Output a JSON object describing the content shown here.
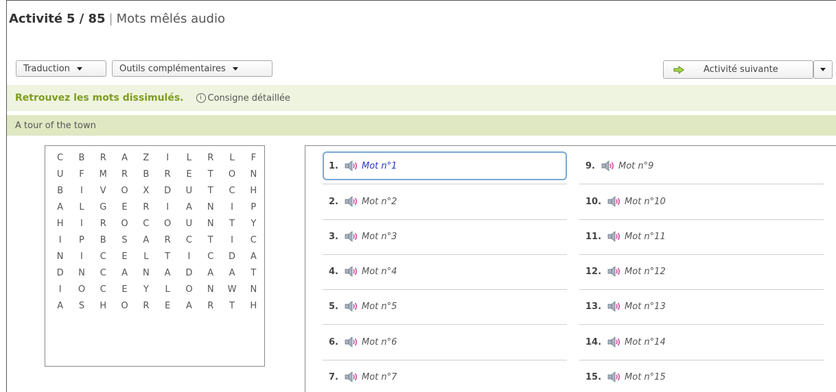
{
  "header": {
    "activity_prefix": "Activité",
    "activity_progress": "5 / 85",
    "separator": "|",
    "activity_name": "Mots mêlés audio"
  },
  "toolbar": {
    "translation_label": "Traduction",
    "tools_label": "Outils complémentaires",
    "next_label": "Activité suivante"
  },
  "instruction": {
    "main": "Retrouvez les mots dissimulés.",
    "detail_icon": "ⓘ",
    "detail": "Consigne détaillée"
  },
  "subtitle": "A tour of the town",
  "grid": [
    [
      "C",
      "B",
      "R",
      "A",
      "Z",
      "I",
      "L",
      "R",
      "L",
      "F"
    ],
    [
      "U",
      "F",
      "M",
      "R",
      "B",
      "R",
      "E",
      "T",
      "O",
      "N"
    ],
    [
      "B",
      "I",
      "V",
      "O",
      "X",
      "D",
      "U",
      "T",
      "C",
      "H"
    ],
    [
      "A",
      "L",
      "G",
      "E",
      "R",
      "I",
      "A",
      "N",
      "I",
      "P"
    ],
    [
      "H",
      "I",
      "R",
      "O",
      "C",
      "O",
      "U",
      "N",
      "T",
      "Y"
    ],
    [
      "I",
      "P",
      "B",
      "S",
      "A",
      "R",
      "C",
      "T",
      "I",
      "C"
    ],
    [
      "N",
      "I",
      "C",
      "E",
      "L",
      "T",
      "I",
      "C",
      "D",
      "A"
    ],
    [
      "D",
      "N",
      "C",
      "A",
      "N",
      "A",
      "D",
      "A",
      "A",
      "T"
    ],
    [
      "I",
      "O",
      "C",
      "E",
      "Y",
      "L",
      "O",
      "N",
      "W",
      "N"
    ],
    [
      "A",
      "S",
      "H",
      "O",
      "R",
      "E",
      "A",
      "R",
      "T",
      "H"
    ]
  ],
  "words_left": [
    {
      "num": "1.",
      "label": "Mot n°1"
    },
    {
      "num": "2.",
      "label": "Mot n°2"
    },
    {
      "num": "3.",
      "label": "Mot n°3"
    },
    {
      "num": "4.",
      "label": "Mot n°4"
    },
    {
      "num": "5.",
      "label": "Mot n°5"
    },
    {
      "num": "6.",
      "label": "Mot n°6"
    },
    {
      "num": "7.",
      "label": "Mot n°7"
    }
  ],
  "words_right": [
    {
      "num": "9.",
      "label": "Mot n°9"
    },
    {
      "num": "10.",
      "label": "Mot n°10"
    },
    {
      "num": "11.",
      "label": "Mot n°11"
    },
    {
      "num": "12.",
      "label": "Mot n°12"
    },
    {
      "num": "13.",
      "label": "Mot n°13"
    },
    {
      "num": "14.",
      "label": "Mot n°14"
    },
    {
      "num": "15.",
      "label": "Mot n°15"
    }
  ],
  "icons": {
    "speaker": "speaker-icon",
    "next_arrow": "arrow-right-icon"
  },
  "colors": {
    "accent_green": "#7f9b1f",
    "instruction_bg": "#eef4df",
    "subtitle_bg": "#dfe8c2",
    "active_border": "#7aa7d8",
    "active_text": "#2a36c9"
  }
}
